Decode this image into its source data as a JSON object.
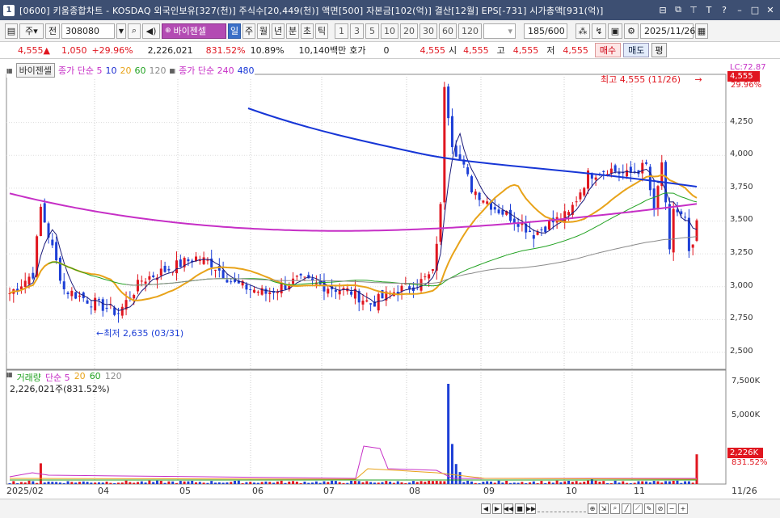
{
  "window": {
    "number": "1",
    "title": "[0600] 키움종합차트 - KOSDAQ 외국인보유[327(천)] 주식수[20,449(천)] 액면[500] 자본금[102(억)] 결산[12월] EPS[-731] 시가총액[931(억)]"
  },
  "toolbar": {
    "stock_type": "주",
    "prev_label": "전",
    "code": "308080",
    "stock_name": "바이젠셀",
    "periods": [
      "일",
      "주",
      "월",
      "년",
      "분",
      "초",
      "틱"
    ],
    "active_period": "일",
    "intervals": [
      "1",
      "3",
      "5",
      "10",
      "20",
      "30",
      "60",
      "120"
    ],
    "bars_display": "185/600",
    "date": "2025/11/26"
  },
  "quote": {
    "price": "4,555",
    "up_arrow": "▲",
    "change": "1,050",
    "change_pct": "+29.96%",
    "volume": "2,226,021",
    "volume_ratio": "831.52%",
    "turnover_pct": "10.89%",
    "trade_value": "10,140백만",
    "hoga_label": "호가",
    "hoga_value": "0",
    "price2": "4,555",
    "open_label": "시",
    "open": "4,555",
    "high_label": "고",
    "high": "4,555",
    "low_label": "저",
    "low": "4,555",
    "buy_button": "매수",
    "sell_button": "매도",
    "eval_button": "평"
  },
  "price_legend": {
    "name_tag": "바이젠셀",
    "ma_label": "종가 단순 5",
    "ma_periods": [
      "10",
      "20",
      "60",
      "120"
    ],
    "ma_long_label": "종가 단순 240",
    "ma_long2": "480"
  },
  "price_axis": {
    "ticks": [
      "4,250",
      "4,000",
      "3,750",
      "3,500",
      "3,250",
      "3,000",
      "2,750",
      "2,500"
    ],
    "lc_label": "LC:72.87",
    "current_tag": "4,555",
    "current_pct": "29.96%"
  },
  "annotations": {
    "high_note": "최고 4,555 (11/26)",
    "high_arrow": "→",
    "low_note": "최저 2,635 (03/31)",
    "low_arrow": "←"
  },
  "volume_legend": {
    "label": "거래량",
    "ma_label": "단순 5",
    "ma_periods": [
      "20",
      "60",
      "120"
    ],
    "info": "2,226,021주(831.52%)"
  },
  "volume_axis": {
    "ticks": [
      "7,500K",
      "5,000K"
    ],
    "current_tag": "2,226K",
    "current_pct": "831.52%"
  },
  "x_axis": {
    "labels": [
      "2025/02",
      "04",
      "05",
      "06",
      "07",
      "08",
      "09",
      "10",
      "11",
      "11/26"
    ]
  },
  "colors": {
    "up": "#e0161f",
    "down": "#1d3fd6",
    "ma5": "#1a1a7a",
    "ma10": "#1b2bd0",
    "ma20": "#e8a319",
    "ma60": "#21a221",
    "ma120": "#8a8a8a",
    "ma240": "#c62fc6",
    "ma480": "#1736d6"
  }
}
